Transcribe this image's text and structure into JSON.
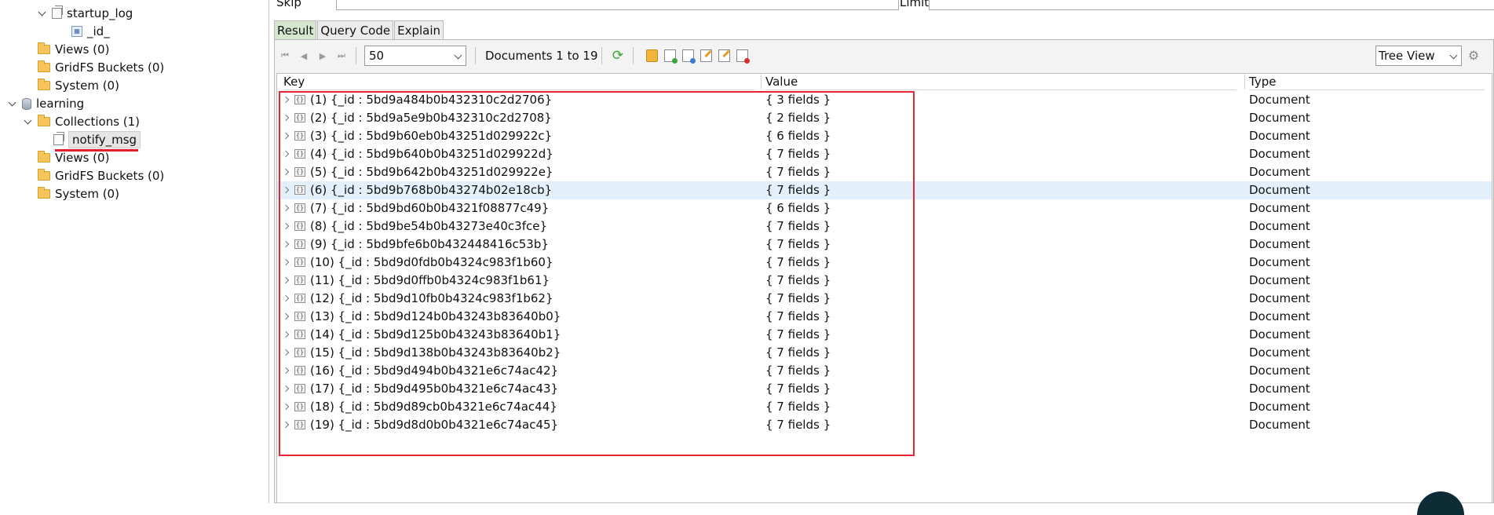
{
  "tree": {
    "items": [
      {
        "label": "startup_log",
        "kind": "collection",
        "expanded": true
      },
      {
        "label": "_id_",
        "kind": "index"
      },
      {
        "label": "Views (0)",
        "kind": "folder"
      },
      {
        "label": "GridFS Buckets (0)",
        "kind": "folder"
      },
      {
        "label": "System (0)",
        "kind": "folder"
      },
      {
        "label": "learning",
        "kind": "database",
        "expanded": true
      },
      {
        "label": "Collections (1)",
        "kind": "folder",
        "expanded": true
      },
      {
        "label": "notify_msg",
        "kind": "collection",
        "selected": true
      },
      {
        "label": "Views (0)",
        "kind": "folder"
      },
      {
        "label": "GridFS Buckets (0)",
        "kind": "folder"
      },
      {
        "label": "System (0)",
        "kind": "folder"
      }
    ]
  },
  "query": {
    "skip_label": "Skip",
    "limit_label": "Limit"
  },
  "tabs": [
    {
      "label": "Result",
      "active": true
    },
    {
      "label": "Query Code",
      "active": false
    },
    {
      "label": "Explain",
      "active": false
    }
  ],
  "toolbar": {
    "page_size": "50",
    "documents_range": "Documents 1 to 19",
    "view_mode": "Tree View"
  },
  "grid": {
    "columns": [
      "Key",
      "Value",
      "Type"
    ],
    "rows": [
      {
        "key": "(1) {_id : 5bd9a484b0b432310c2d2706}",
        "value": "{ 3 fields }",
        "type": "Document"
      },
      {
        "key": "(2) {_id : 5bd9a5e9b0b432310c2d2708}",
        "value": "{ 2 fields }",
        "type": "Document"
      },
      {
        "key": "(3) {_id : 5bd9b60eb0b43251d029922c}",
        "value": "{ 6 fields }",
        "type": "Document"
      },
      {
        "key": "(4) {_id : 5bd9b640b0b43251d029922d}",
        "value": "{ 7 fields }",
        "type": "Document"
      },
      {
        "key": "(5) {_id : 5bd9b642b0b43251d029922e}",
        "value": "{ 7 fields }",
        "type": "Document"
      },
      {
        "key": "(6) {_id : 5bd9b768b0b43274b02e18cb}",
        "value": "{ 7 fields }",
        "type": "Document",
        "highlight": true
      },
      {
        "key": "(7) {_id : 5bd9bd60b0b4321f08877c49}",
        "value": "{ 6 fields }",
        "type": "Document"
      },
      {
        "key": "(8) {_id : 5bd9be54b0b43273e40c3fce}",
        "value": "{ 7 fields }",
        "type": "Document"
      },
      {
        "key": "(9) {_id : 5bd9bfe6b0b432448416c53b}",
        "value": "{ 7 fields }",
        "type": "Document"
      },
      {
        "key": "(10) {_id : 5bd9d0fdb0b4324c983f1b60}",
        "value": "{ 7 fields }",
        "type": "Document"
      },
      {
        "key": "(11) {_id : 5bd9d0ffb0b4324c983f1b61}",
        "value": "{ 7 fields }",
        "type": "Document"
      },
      {
        "key": "(12) {_id : 5bd9d10fb0b4324c983f1b62}",
        "value": "{ 7 fields }",
        "type": "Document"
      },
      {
        "key": "(13) {_id : 5bd9d124b0b43243b83640b0}",
        "value": "{ 7 fields }",
        "type": "Document"
      },
      {
        "key": "(14) {_id : 5bd9d125b0b43243b83640b1}",
        "value": "{ 7 fields }",
        "type": "Document"
      },
      {
        "key": "(15) {_id : 5bd9d138b0b43243b83640b2}",
        "value": "{ 7 fields }",
        "type": "Document"
      },
      {
        "key": "(16) {_id : 5bd9d494b0b4321e6c74ac42}",
        "value": "{ 7 fields }",
        "type": "Document"
      },
      {
        "key": "(17) {_id : 5bd9d495b0b4321e6c74ac43}",
        "value": "{ 7 fields }",
        "type": "Document"
      },
      {
        "key": "(18) {_id : 5bd9d89cb0b4321e6c74ac44}",
        "value": "{ 7 fields }",
        "type": "Document"
      },
      {
        "key": "(19) {_id : 5bd9d8d0b0b4321e6c74ac45}",
        "value": "{ 7 fields }",
        "type": "Document"
      }
    ]
  },
  "colors": {
    "annotation_red": "#e32630",
    "active_tab": "#d5e8cf",
    "row_highlight": "#e3f0fb",
    "refresh_green": "#3aa53a"
  }
}
